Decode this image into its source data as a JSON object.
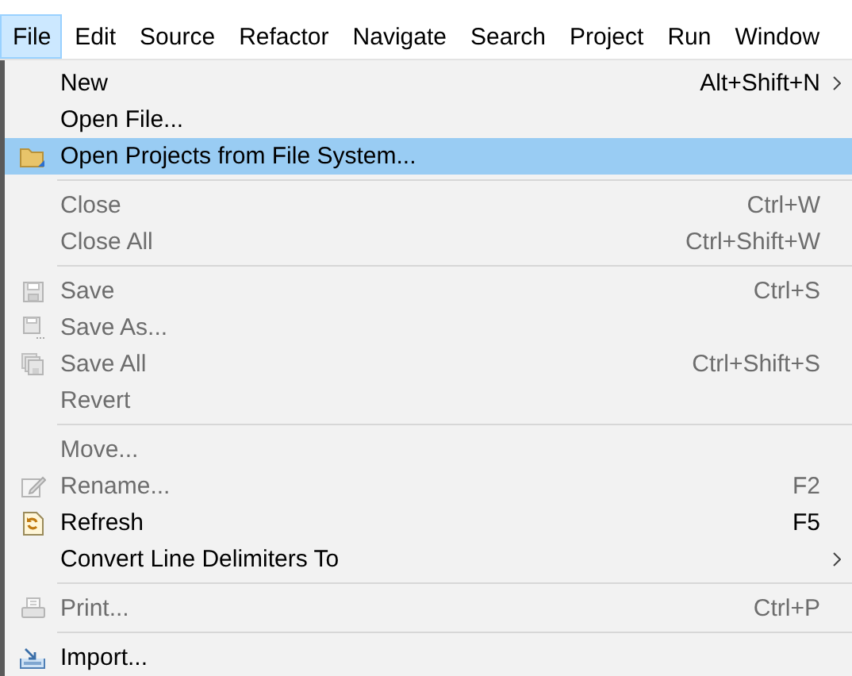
{
  "menubar": [
    {
      "label": "File",
      "selected": true
    },
    {
      "label": "Edit",
      "selected": false
    },
    {
      "label": "Source",
      "selected": false
    },
    {
      "label": "Refactor",
      "selected": false
    },
    {
      "label": "Navigate",
      "selected": false
    },
    {
      "label": "Search",
      "selected": false
    },
    {
      "label": "Project",
      "selected": false
    },
    {
      "label": "Run",
      "selected": false
    },
    {
      "label": "Window",
      "selected": false
    }
  ],
  "menu": {
    "sections": [
      {
        "items": [
          {
            "label": "New",
            "shortcut": "Alt+Shift+N",
            "disabled": false,
            "selected": false,
            "submenu": true
          },
          {
            "label": "Open File...",
            "disabled": false,
            "selected": false,
            "submenu": false
          },
          {
            "label": "Open Projects from File System...",
            "kind": "folder",
            "disabled": false,
            "selected": true,
            "submenu": false
          }
        ]
      },
      {
        "items": [
          {
            "label": "Close",
            "shortcut": "Ctrl+W",
            "disabled": true,
            "selected": false,
            "submenu": false
          },
          {
            "label": "Close All",
            "shortcut": "Ctrl+Shift+W",
            "disabled": true,
            "selected": false,
            "submenu": false
          }
        ]
      },
      {
        "items": [
          {
            "label": "Save",
            "shortcut": "Ctrl+S",
            "kind": "save",
            "disabled": true,
            "selected": false,
            "submenu": false
          },
          {
            "label": "Save As...",
            "kind": "save-as",
            "disabled": true,
            "selected": false,
            "submenu": false
          },
          {
            "label": "Save All",
            "shortcut": "Ctrl+Shift+S",
            "kind": "save-all",
            "disabled": true,
            "selected": false,
            "submenu": false
          },
          {
            "label": "Revert",
            "disabled": true,
            "selected": false,
            "submenu": false
          }
        ]
      },
      {
        "items": [
          {
            "label": "Move...",
            "disabled": true,
            "selected": false,
            "submenu": false
          },
          {
            "label": "Rename...",
            "shortcut": "F2",
            "kind": "rename",
            "disabled": true,
            "selected": false,
            "submenu": false
          },
          {
            "label": "Refresh",
            "shortcut": "F5",
            "kind": "refresh",
            "disabled": false,
            "selected": false,
            "submenu": false
          },
          {
            "label": "Convert Line Delimiters To",
            "disabled": false,
            "selected": false,
            "submenu": true
          }
        ]
      },
      {
        "items": [
          {
            "label": "Print...",
            "shortcut": "Ctrl+P",
            "kind": "print",
            "disabled": true,
            "selected": false,
            "submenu": false
          }
        ]
      },
      {
        "items": [
          {
            "label": "Import...",
            "kind": "import",
            "disabled": false,
            "selected": false,
            "submenu": false
          }
        ]
      }
    ]
  }
}
